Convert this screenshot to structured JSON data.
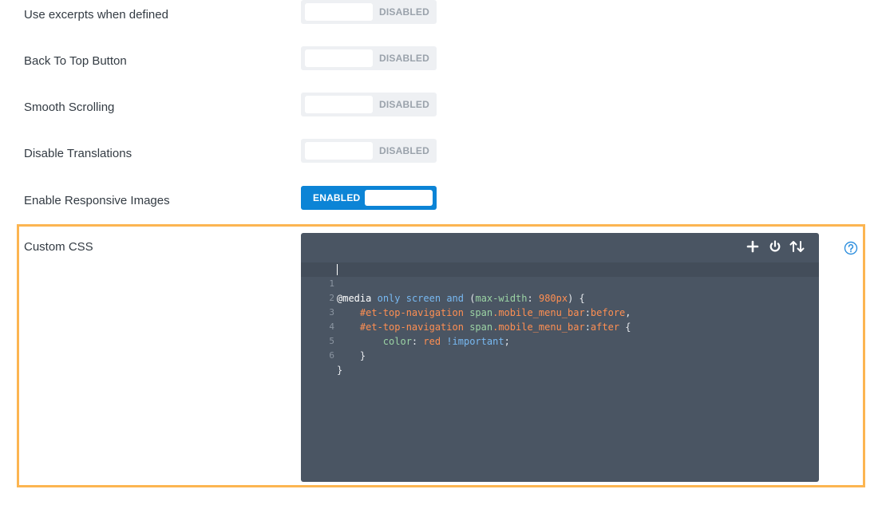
{
  "settings": [
    {
      "label": "Use excerpts when defined",
      "state": "DISABLED"
    },
    {
      "label": "Back To Top Button",
      "state": "DISABLED"
    },
    {
      "label": "Smooth Scrolling",
      "state": "DISABLED"
    },
    {
      "label": "Disable Translations",
      "state": "DISABLED"
    },
    {
      "label": "Enable Responsive Images",
      "state": "ENABLED"
    }
  ],
  "custom_css": {
    "label": "Custom CSS",
    "toolbar_icons": [
      "plus-icon",
      "power-icon",
      "sort-arrows-icon"
    ],
    "help_icon": "question-circle-icon",
    "line_numbers": [
      "1",
      "2",
      "3",
      "4",
      "5",
      "6"
    ]
  },
  "colors": {
    "enabled": "#0c84d6",
    "editor_bg": "#4a5563",
    "highlight": "#fcb551"
  }
}
